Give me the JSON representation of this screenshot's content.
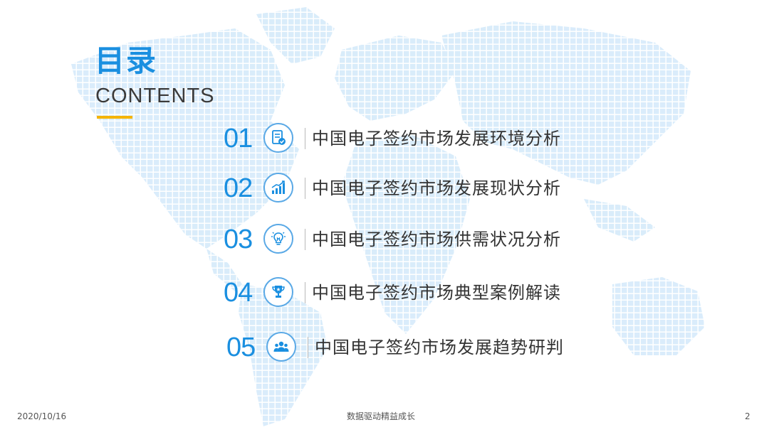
{
  "title": {
    "cn": "目录",
    "en": "CONTENTS"
  },
  "toc": [
    {
      "num": "01",
      "icon": "document-check-icon",
      "label": "中国电子签约市场发展环境分析"
    },
    {
      "num": "02",
      "icon": "growth-chart-icon",
      "label": "中国电子签约市场发展现状分析"
    },
    {
      "num": "03",
      "icon": "lightbulb-icon",
      "label": "中国电子签约市场供需状况分析"
    },
    {
      "num": "04",
      "icon": "trophy-icon",
      "label": "中国电子签约市场典型案例解读"
    },
    {
      "num": "05",
      "icon": "people-icon",
      "label": "中国电子签约市场发展趋势研判"
    }
  ],
  "footer": {
    "date": "2020/10/16",
    "slogan": "数据驱动精益成长",
    "page": "2"
  },
  "colors": {
    "accent_blue": "#1a8fe0",
    "accent_yellow": "#f5b400",
    "text_dark": "#333333",
    "map_blue": "#d6ebfa"
  }
}
